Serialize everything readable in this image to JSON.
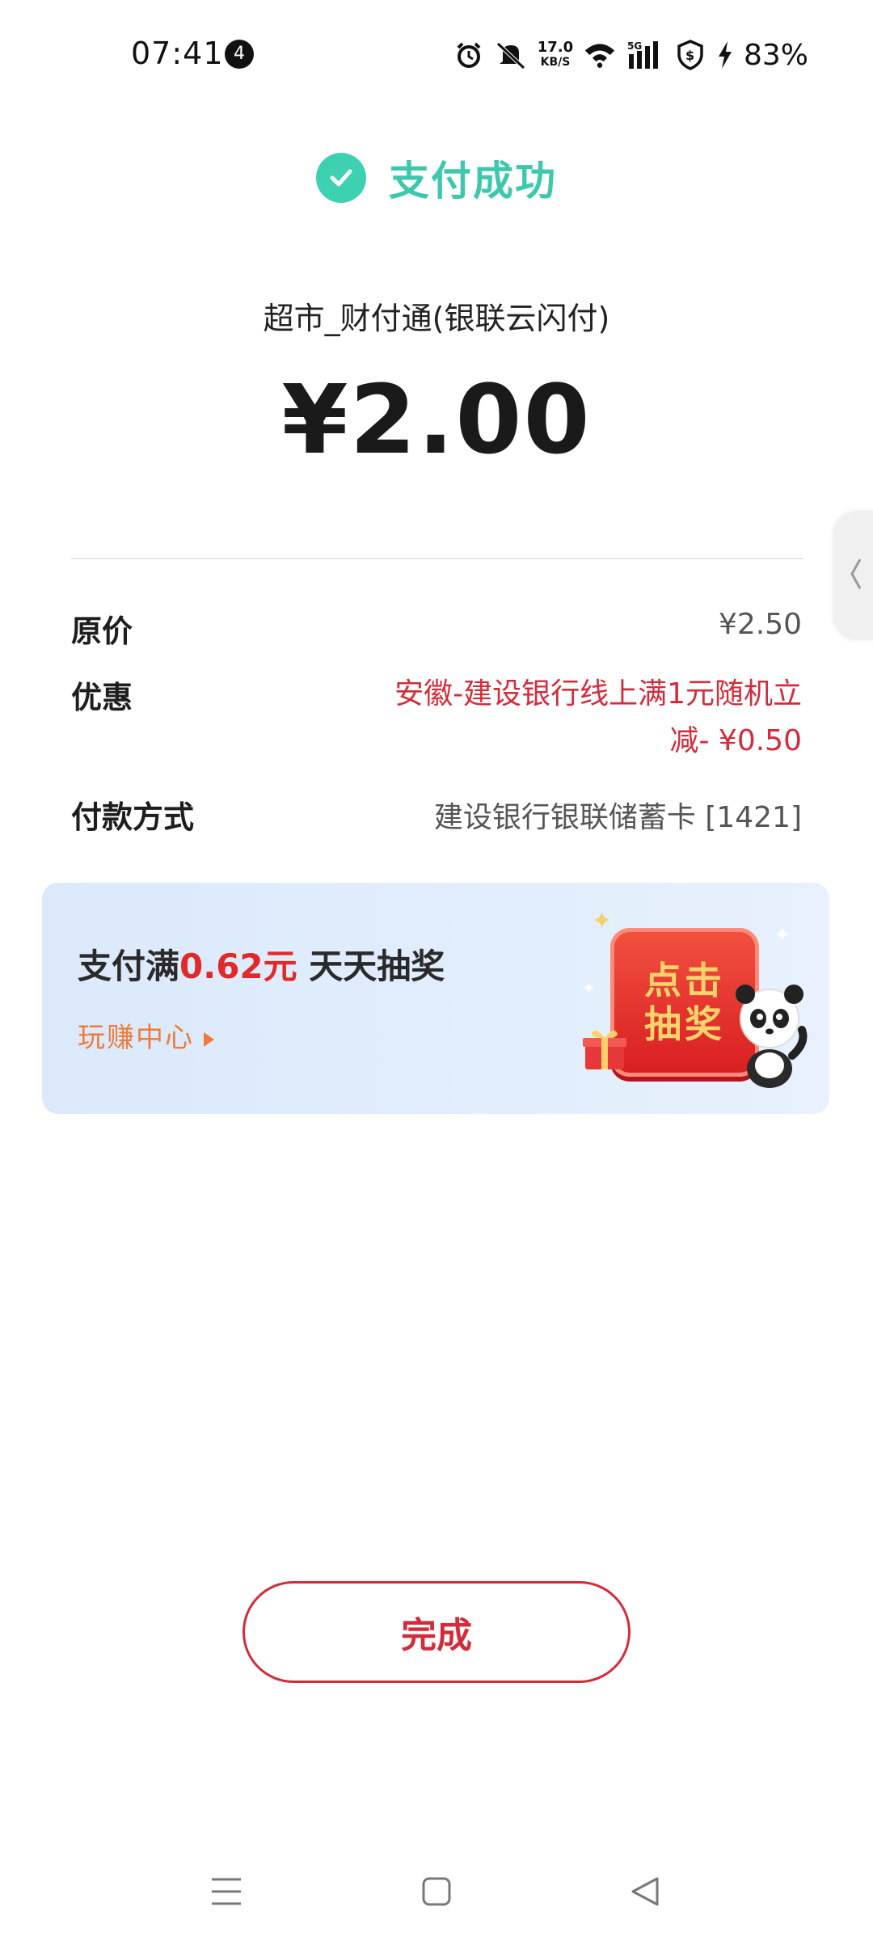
{
  "status_bar": {
    "time": "07:41",
    "notification_count": "4",
    "net_speed_value": "17.0",
    "net_speed_unit": "KB/S",
    "network_type": "5G",
    "battery": "83%",
    "icons": [
      "alarm-icon",
      "mute-icon",
      "wifi-icon",
      "signal-icon",
      "vpn-shield-icon",
      "charging-icon"
    ]
  },
  "header": {
    "status_text": "支付成功",
    "accent_color": "#3dc8ad"
  },
  "payment": {
    "merchant": "超市_财付通(银联云闪付)",
    "amount": "¥2.00"
  },
  "details": {
    "original_price_label": "原价",
    "original_price_value": "¥2.50",
    "discount_label": "优惠",
    "discount_value_line1": "安徽-建设银行线上满1元随机立",
    "discount_value_line2": "减- ¥0.50",
    "method_label": "付款方式",
    "method_value": "建设银行银联储蓄卡 [1421]",
    "discount_color": "#d42b3a"
  },
  "banner": {
    "title_prefix": "支付满",
    "title_amount": "0.62元",
    "title_suffix": " 天天抽奖",
    "link_text": "玩赚中心",
    "lottery_line1": "点击",
    "lottery_line2": "抽奖"
  },
  "actions": {
    "done_label": "完成",
    "brand_color": "#d42b3a"
  },
  "nav_bar": {
    "icons": [
      "menu-icon",
      "home-icon",
      "back-icon"
    ]
  }
}
